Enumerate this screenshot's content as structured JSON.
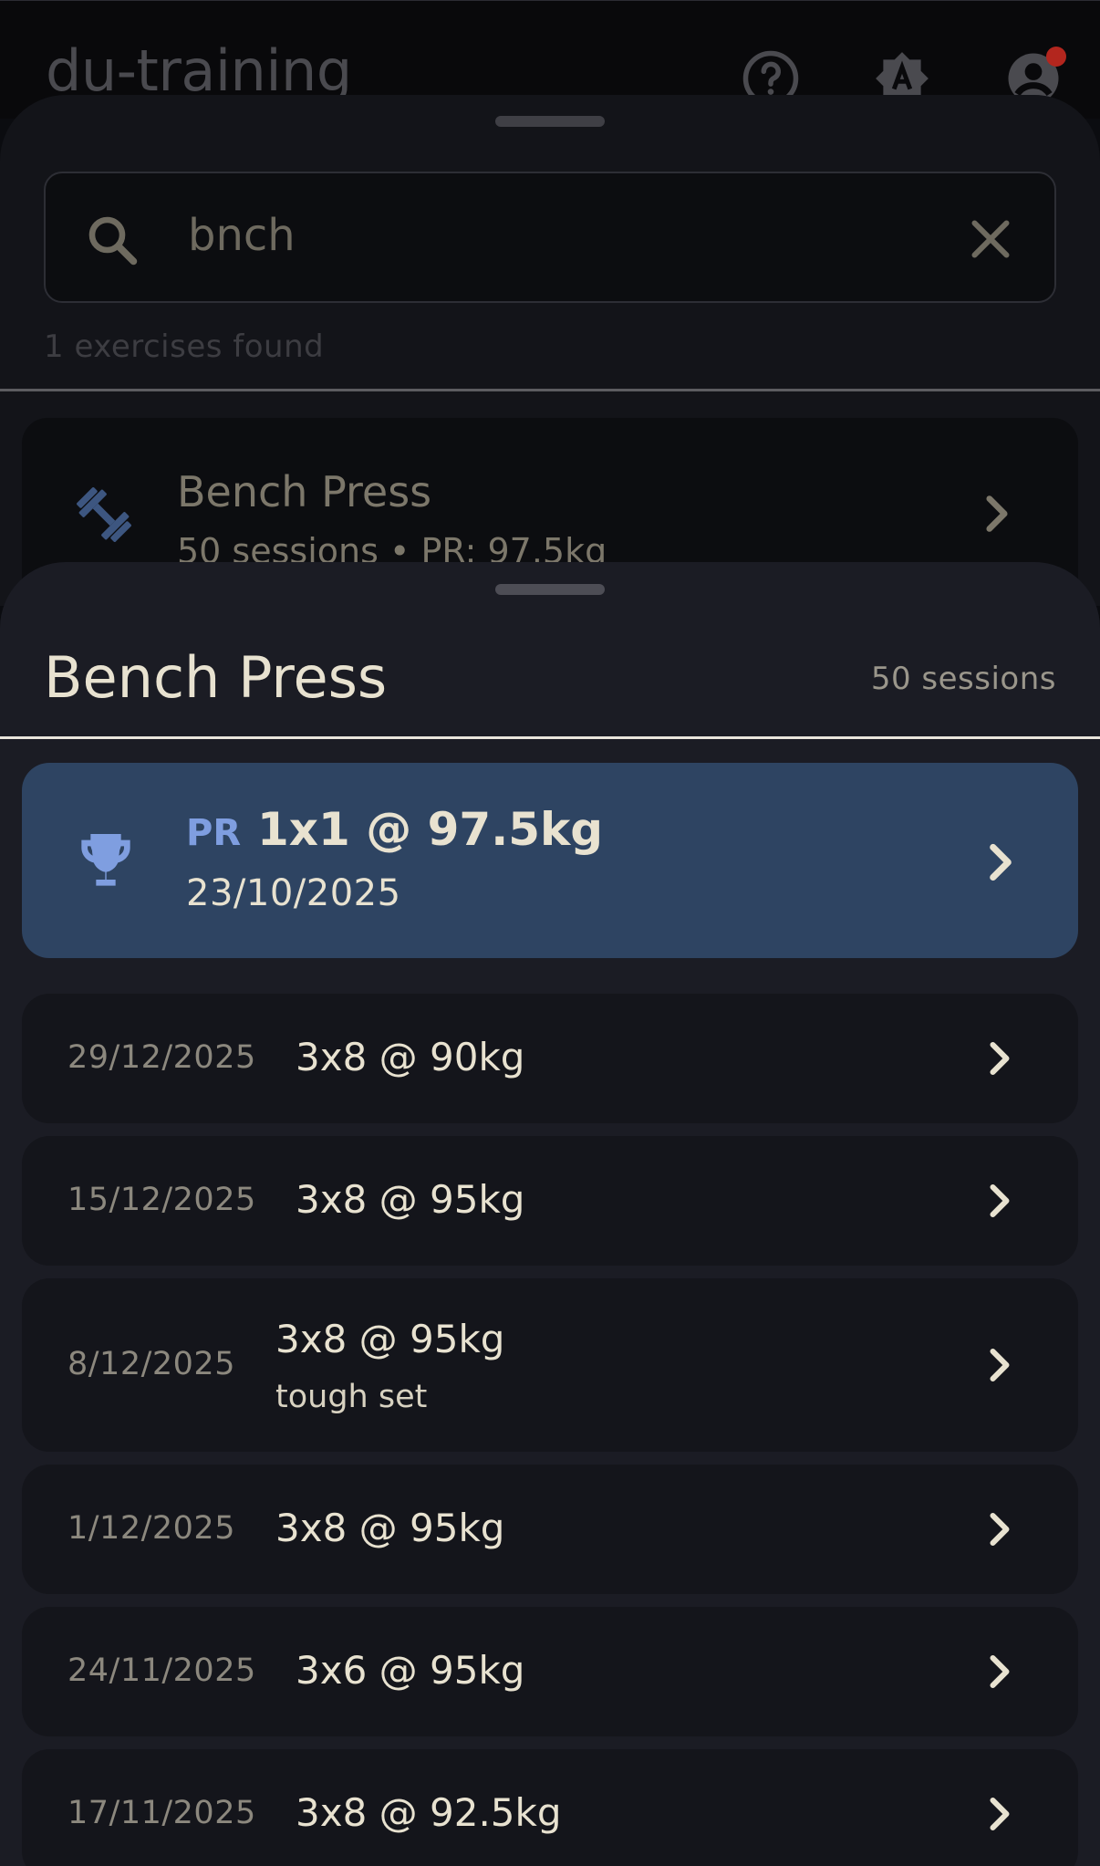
{
  "app": {
    "title": "du-training",
    "icons": [
      "help-circle-icon",
      "translate-icon",
      "account-icon"
    ]
  },
  "search": {
    "value": "bnch",
    "result_count_text": "1 exercises found",
    "results": [
      {
        "name": "Bench Press",
        "meta": "50 sessions • PR: 97.5kg"
      }
    ]
  },
  "detail": {
    "title": "Bench Press",
    "sessions_count": "50 sessions",
    "pr": {
      "badge": "PR",
      "value": "1x1 @ 97.5kg",
      "date": "23/10/2025"
    },
    "sessions": [
      {
        "date": "29/12/2025",
        "value": "3x8 @ 90kg",
        "note": ""
      },
      {
        "date": "15/12/2025",
        "value": "3x8 @ 95kg",
        "note": ""
      },
      {
        "date": "8/12/2025",
        "value": "3x8 @ 95kg",
        "note": "tough set"
      },
      {
        "date": "1/12/2025",
        "value": "3x8 @ 95kg",
        "note": ""
      },
      {
        "date": "24/11/2025",
        "value": "3x6 @ 95kg",
        "note": ""
      },
      {
        "date": "17/11/2025",
        "value": "3x8 @ 92.5kg",
        "note": ""
      }
    ]
  },
  "colors": {
    "background": "#0b0c10",
    "sheet": "#1b1c24",
    "pr_card": "#2e4462",
    "pr_accent": "#7f9ee0",
    "text": "#e8e2d0",
    "notification": "#b3261e"
  }
}
